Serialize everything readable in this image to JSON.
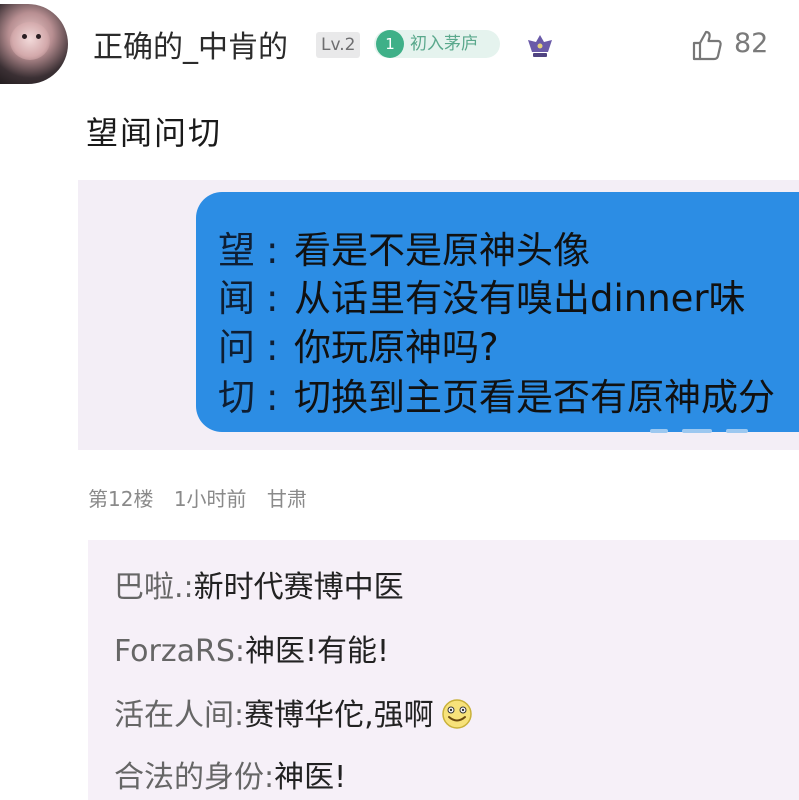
{
  "header": {
    "username": "正确的_中肯的",
    "level": "Lv.2",
    "badge_number": "1",
    "badge_text": "初入茅庐",
    "like_count": "82"
  },
  "post": {
    "title": "望闻问切",
    "image_rows": [
      {
        "key": "望",
        "sep": ":",
        "text": "看是不是原神头像"
      },
      {
        "key": "闻",
        "sep": ":",
        "text": "从话里有没有嗅出dinner味"
      },
      {
        "key": "问",
        "sep": ":",
        "text": "你玩原神吗?"
      },
      {
        "key": "切",
        "sep": ":",
        "text": "切换到主页看是否有原神成分"
      }
    ],
    "meta": {
      "floor": "第12楼",
      "time": "1小时前",
      "location": "甘肃"
    }
  },
  "replies": [
    {
      "author": "巴啦.",
      "sep": ":",
      "text": "新时代赛博中医"
    },
    {
      "author": "ForzaRS",
      "sep": ":",
      "text": "神医!有能!"
    },
    {
      "author": "活在人间",
      "sep": ":",
      "text": "赛博华佗,强啊"
    },
    {
      "author": "合法的身份",
      "sep": ":",
      "text": "神医!"
    }
  ],
  "colors": {
    "bubble": "#2c8de4",
    "badge": "#3fb088",
    "reply_bg": "#f6f0f8"
  },
  "icons": {
    "like": "thumbs-up-icon",
    "crown": "crown-icon",
    "smile": "smile-emoji-icon"
  }
}
